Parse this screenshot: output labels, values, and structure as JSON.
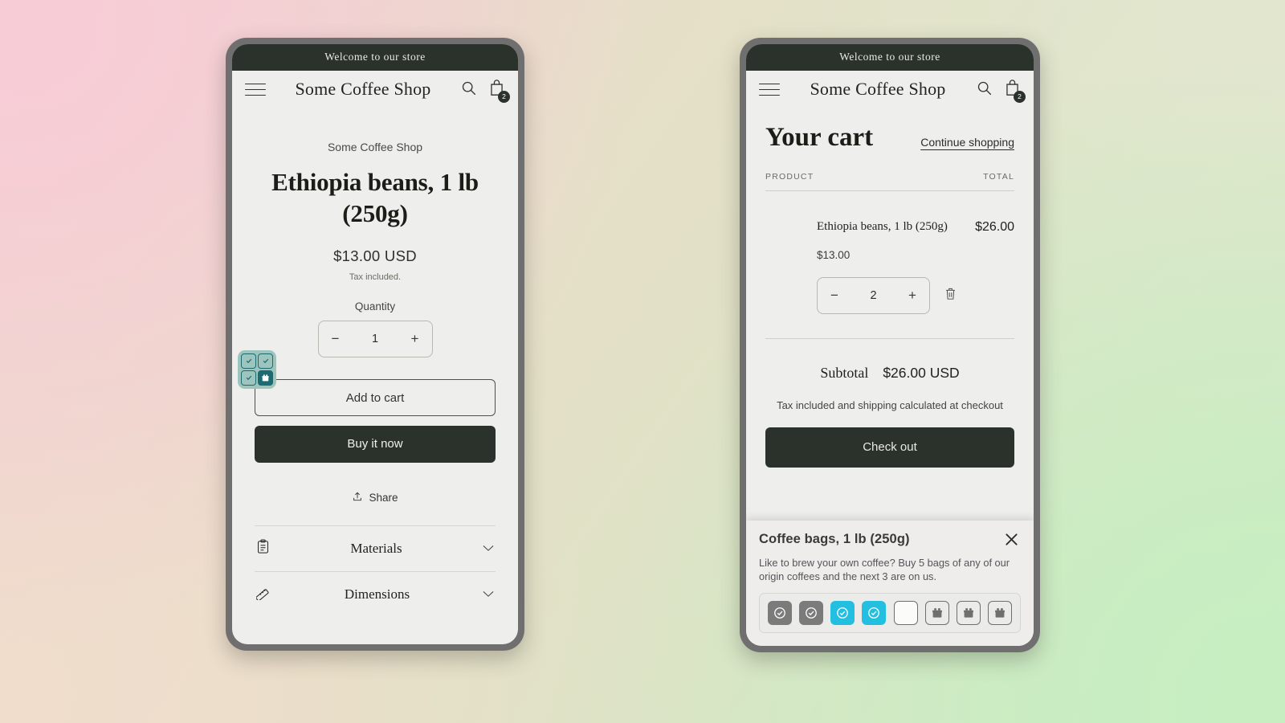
{
  "background": {
    "gradient_from": "#f0cfd3",
    "gradient_mid": "#e3e2c7",
    "gradient_to": "#cdecc5"
  },
  "theme": {
    "dark": "#2b322c",
    "screen_bg": "#eeeeec",
    "bezel": "#706f6f",
    "accent_cyan": "#22bfe0",
    "stamp_used_gray": "#7b7b7b",
    "widget_teal": "#9dc5bd",
    "widget_teal_dark": "#1d6b72"
  },
  "phone_product": {
    "announcement": "Welcome to our store",
    "header": {
      "menu_icon": "hamburger-icon",
      "store_name": "Some Coffee Shop",
      "search_icon": "search-icon",
      "cart_icon": "shopping-bag-icon",
      "cart_count": "2"
    },
    "product": {
      "vendor": "Some Coffee Shop",
      "title": "Ethiopia beans, 1 lb (250g)",
      "price": "$13.00 USD",
      "tax_note": "Tax included.",
      "quantity_label": "Quantity",
      "quantity_decrease": "−",
      "quantity_value": "1",
      "quantity_increase": "+",
      "add_to_cart_label": "Add to cart",
      "buy_now_label": "Buy it now",
      "share_label": "Share",
      "share_icon": "share-icon"
    },
    "accordion": [
      {
        "label": "Materials",
        "icon": "clipboard-icon",
        "chevron": "chevron-down-icon"
      },
      {
        "label": "Dimensions",
        "icon": "ruler-icon",
        "chevron": "chevron-down-icon"
      }
    ],
    "mini_widget": {
      "name": "loyalty-stamp-widget",
      "tiles": [
        {
          "state": "check-outline"
        },
        {
          "state": "check-outline"
        },
        {
          "state": "check-outline"
        },
        {
          "state": "gift-filled"
        }
      ]
    }
  },
  "phone_cart": {
    "announcement": "Welcome to our store",
    "header": {
      "menu_icon": "hamburger-icon",
      "store_name": "Some Coffee Shop",
      "search_icon": "search-icon",
      "cart_icon": "shopping-bag-icon",
      "cart_count": "2"
    },
    "cart": {
      "title": "Your cart",
      "continue_shopping": "Continue shopping",
      "col_product": "PRODUCT",
      "col_total": "TOTAL",
      "item": {
        "name": "Ethiopia beans, 1 lb (250g)",
        "unit_price": "$13.00",
        "line_total": "$26.00",
        "quantity_decrease": "−",
        "quantity_value": "2",
        "quantity_increase": "+",
        "remove_icon": "trash-icon"
      },
      "subtotal_label": "Subtotal",
      "subtotal_value": "$26.00 USD",
      "shipping_note": "Tax included and shipping calculated at checkout",
      "checkout_label": "Check out"
    },
    "popup": {
      "title": "Coffee bags, 1 lb (250g)",
      "body": "Like to brew your own coffee? Buy 5 bags of any of our origin coffees and the next 3 are on us.",
      "close_icon": "close-icon",
      "stamps": [
        {
          "state": "used",
          "icon": "check-circle-icon"
        },
        {
          "state": "used",
          "icon": "check-circle-icon"
        },
        {
          "state": "active",
          "icon": "check-circle-icon"
        },
        {
          "state": "active",
          "icon": "check-circle-icon"
        },
        {
          "state": "empty",
          "icon": "blank-icon"
        },
        {
          "state": "gift",
          "icon": "gift-icon"
        },
        {
          "state": "gift",
          "icon": "gift-icon"
        },
        {
          "state": "gift",
          "icon": "gift-icon"
        }
      ]
    }
  }
}
